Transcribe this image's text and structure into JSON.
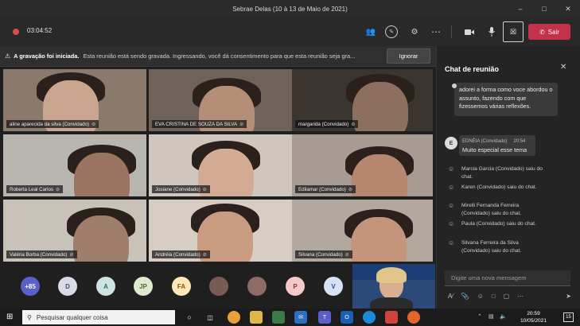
{
  "window": {
    "title": "Sebrae Delas (10 à 13 de Maio de 2021)"
  },
  "toolbar": {
    "timer": "03:04:52",
    "leave_label": "Sair"
  },
  "banner": {
    "title": "A gravação foi iniciada.",
    "message": "Esta reunião está sendo gravada. Ingressando, você dá consentimento para que esta reunião seja gra...",
    "ignore_label": "Ignorar"
  },
  "tiles": [
    {
      "name": "aline aparecida da silva (Convidado)",
      "bg": "#8a7a6c",
      "face": "#c9a48e"
    },
    {
      "name": "EVA CRISTINA DE SOUZA DA SILVA",
      "bg": "#6f6258",
      "face": "#b58e77"
    },
    {
      "name": "margarida (Convidado)",
      "bg": "#3b3530",
      "face": "#8c6f5e"
    },
    {
      "name": "Roberta Leal Carlos",
      "bg": "#b9b6b0",
      "face": "#9a7460"
    },
    {
      "name": "Josiane (Convidado)",
      "bg": "#cfc6bd",
      "face": "#d3ab94"
    },
    {
      "name": "Edilamar (Convidado)",
      "bg": "#a89b92",
      "face": "#b7866f"
    },
    {
      "name": "Valéria Borba (Convidado)",
      "bg": "#c8c2b8",
      "face": "#a07e6c"
    },
    {
      "name": "Andréia (Convidado)",
      "bg": "#d7cdc3",
      "face": "#c99c82"
    },
    {
      "name": "Silvana (Convidado)",
      "bg": "#b3a89d",
      "face": "#c4947b"
    }
  ],
  "avatars": [
    {
      "text": "+85",
      "bg": "#5b5fc7",
      "fg": "#ffffff"
    },
    {
      "text": "D",
      "bg": "#d9dbe6",
      "fg": "#4a4f7a"
    },
    {
      "text": "A",
      "bg": "#cfe3e2",
      "fg": "#2f6b69"
    },
    {
      "text": "JP",
      "bg": "#dfe9cf",
      "fg": "#4d6b2e"
    },
    {
      "text": "FA",
      "bg": "#fde6b8",
      "fg": "#8a5a00"
    },
    {
      "text": "",
      "bg": "#7a5a55",
      "fg": "#ffffff"
    },
    {
      "text": "",
      "bg": "#8f6a66",
      "fg": "#ffffff"
    },
    {
      "text": "P",
      "bg": "#f4c9c9",
      "fg": "#8a2f2f"
    },
    {
      "text": "V",
      "bg": "#d6e2f5",
      "fg": "#2f4f8a"
    }
  ],
  "chat": {
    "title": "Chat de reunião",
    "prev_message": "adorei a forma como voce abordou o assunto, fazendo com que fizessemos várias reflexões.",
    "msg_sender": "EDNÉIA (Convidado)",
    "msg_time": "20:54",
    "msg_avatar": "E",
    "msg_text": "Muito especial esse tema",
    "system": [
      "Marcia Garcia (Convidado) saiu do chat.",
      "Karen (Convidado) saiu do chat.",
      "Mirelli Fernanda Ferreira (Convidado) saiu do chat.",
      "Paula (Convidado) saiu do chat.",
      "Silvana Ferreira da Silva (Convidado) saiu do chat."
    ],
    "input_placeholder": "Digite uma nova mensagem"
  },
  "taskbar": {
    "search_placeholder": "Pesquisar qualquer coisa",
    "time": "20:59",
    "date": "10/05/2021",
    "notifications": "15"
  },
  "icons": [
    "windows-logo-icon",
    "search-icon",
    "task-view-icon",
    "camera-icon",
    "mic-icon",
    "phone-icon"
  ]
}
